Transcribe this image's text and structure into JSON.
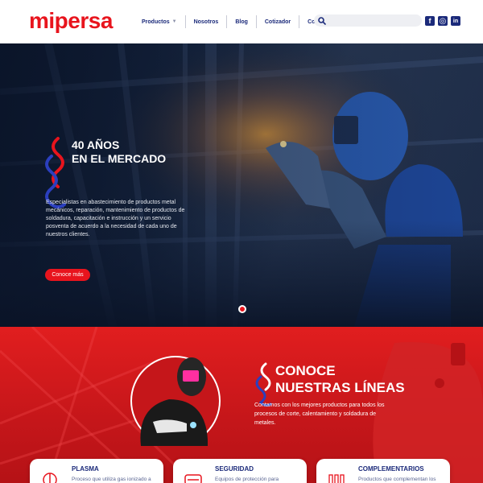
{
  "brand": {
    "logo": "mipersa",
    "accent": "#e8141d",
    "navy": "#1b2a7a"
  },
  "nav": {
    "items": [
      {
        "label": "Productos",
        "has_dropdown": true
      },
      {
        "label": "Nosotros"
      },
      {
        "label": "Blog"
      },
      {
        "label": "Cotizador"
      },
      {
        "label": "Contáctanos"
      }
    ]
  },
  "search": {
    "placeholder": "",
    "icon": "search-icon"
  },
  "socials": [
    {
      "name": "facebook-icon",
      "glyph": "f"
    },
    {
      "name": "instagram-icon",
      "glyph": "◎"
    },
    {
      "name": "linkedin-icon",
      "glyph": "in"
    }
  ],
  "hero": {
    "title_line1": "40 AÑOS",
    "title_line2": "EN EL MERCADO",
    "text": "Especialistas en abastecimiento de productos metal mecánicos, reparación, mantenimiento de productos de soldadura, capacitación e instrucción y un servicio posventa de acuerdo a la necesidad de cada uno de nuestros clientes.",
    "button": "Conoce más"
  },
  "lines": {
    "title_line1": "CONOCE",
    "title_line2": "NUESTRAS LÍNEAS",
    "text": "Contamos con los mejores productos para todos los procesos de corte, calentamiento y soldadura de metales."
  },
  "cards": [
    {
      "title": "PLASMA",
      "desc": "Proceso que utiliza gas ionizado a",
      "icon": "plasma-icon"
    },
    {
      "title": "SEGURIDAD",
      "desc": "Equipos de protección para",
      "icon": "safety-icon"
    },
    {
      "title": "COMPLEMENTARIOS",
      "desc": "Productos que complementan los",
      "icon": "complements-icon"
    }
  ]
}
